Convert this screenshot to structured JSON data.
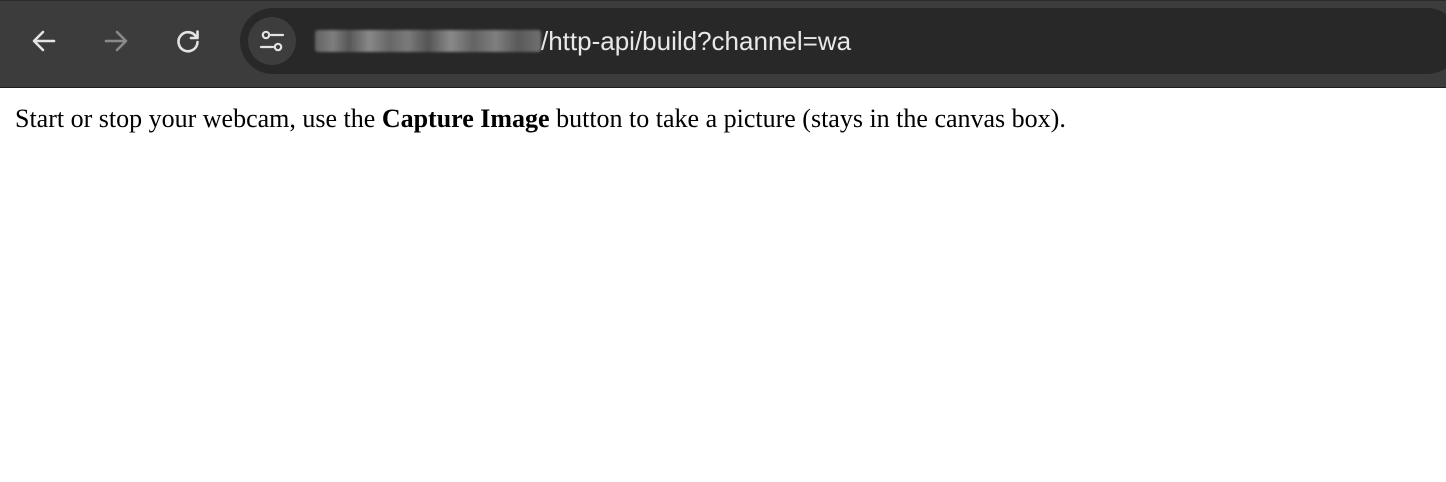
{
  "browser": {
    "url_host": "",
    "url_path": "/http-api/build?channel=wa",
    "icons": [
      "back-arrow-icon",
      "forward-arrow-icon",
      "reload-icon",
      "site-info-icon"
    ],
    "colors": {
      "toolbar": "#3c3c3c",
      "omnibox": "#282828",
      "icon_active": "#e3e3e3",
      "icon_disabled": "#8a8a8a"
    }
  },
  "page": {
    "text_before": "Start or stop your webcam, use the ",
    "text_bold": "Capture Image",
    "text_after": " button to take a picture (stays in the canvas box)."
  }
}
